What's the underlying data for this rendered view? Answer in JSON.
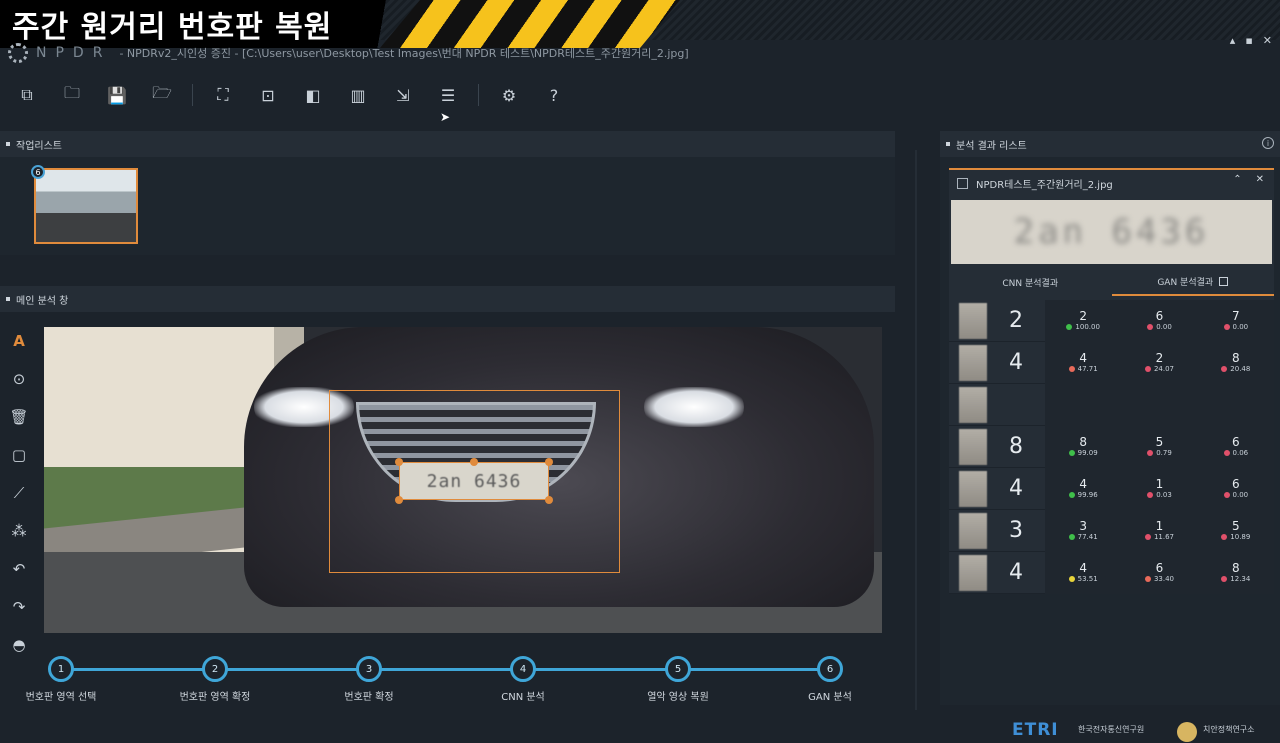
{
  "banner": {
    "title": "주간 원거리 번호판 복원"
  },
  "app": {
    "logo_text": "NPDR",
    "title_path": "- NPDRv2_시인성 증진 - [C:\\Users\\user\\Desktop\\Test Images\\번대 NPDR 테스트\\NPDR테스트_주간원거리_2.jpg]",
    "window_controls": [
      "▴",
      "▪",
      "✕"
    ]
  },
  "toolbar": {
    "buttons": [
      {
        "icon": "copy-icon",
        "glyph": "⧉"
      },
      {
        "icon": "folder-icon",
        "glyph": "🗀"
      },
      {
        "icon": "save-icon",
        "glyph": "💾"
      },
      {
        "icon": "open-folder-icon",
        "glyph": "🗁"
      },
      {
        "icon": "crop-icon",
        "glyph": "⛶"
      },
      {
        "icon": "focus-icon",
        "glyph": "⊡"
      },
      {
        "icon": "image-compare-icon",
        "glyph": "◧"
      },
      {
        "icon": "chart-icon",
        "glyph": "▥"
      },
      {
        "icon": "export-icon",
        "glyph": "⇲"
      },
      {
        "icon": "list-icon",
        "glyph": "☰"
      },
      {
        "icon": "settings-icon",
        "glyph": "⚙"
      },
      {
        "icon": "help-icon",
        "glyph": "?"
      }
    ]
  },
  "panels": {
    "worklist": "작업리스트",
    "main_analysis": "메인 분석 창",
    "result_list": "분석 결과 리스트"
  },
  "worklist": {
    "badge": "6"
  },
  "side_tools": [
    {
      "icon": "text-tool-icon",
      "glyph": "A"
    },
    {
      "icon": "capture-icon",
      "glyph": "⊙"
    },
    {
      "icon": "delete-icon",
      "glyph": "🗑"
    },
    {
      "icon": "rectangle-icon",
      "glyph": "▢"
    },
    {
      "icon": "line-icon",
      "glyph": "⟋"
    },
    {
      "icon": "points-icon",
      "glyph": "⁂"
    },
    {
      "icon": "undo-icon",
      "glyph": "↶"
    },
    {
      "icon": "redo-icon",
      "glyph": "↷"
    },
    {
      "icon": "view-icon",
      "glyph": "◓"
    }
  ],
  "main_image": {
    "plate_text": "2an 6436"
  },
  "steps": [
    {
      "num": "1",
      "label": "번호판 영역 선택"
    },
    {
      "num": "2",
      "label": "번호판 영역 확정"
    },
    {
      "num": "3",
      "label": "번호판 확정"
    },
    {
      "num": "4",
      "label": "CNN 분석"
    },
    {
      "num": "5",
      "label": "열악 영상 복원"
    },
    {
      "num": "6",
      "label": "GAN 분석"
    }
  ],
  "result": {
    "filename": "NPDR테스트_주간원거리_2.jpg",
    "controls": [
      "⌃",
      "✕"
    ],
    "plate_crop_text": "2an 6436",
    "tabs": [
      "CNN 분석결과",
      "GAN 분석결과"
    ],
    "info": "i",
    "rows": [
      {
        "big": "2",
        "cands": [
          {
            "c": "2",
            "p": "100.00",
            "col": "#3fbf4a"
          },
          {
            "c": "6",
            "p": "0.00",
            "col": "#e0506a"
          },
          {
            "c": "7",
            "p": "0.00",
            "col": "#e0506a"
          }
        ]
      },
      {
        "big": "4",
        "cands": [
          {
            "c": "4",
            "p": "47.71",
            "col": "#e86a5a"
          },
          {
            "c": "2",
            "p": "24.07",
            "col": "#e0506a"
          },
          {
            "c": "8",
            "p": "20.48",
            "col": "#e0506a"
          }
        ]
      },
      {
        "big": "",
        "cands": []
      },
      {
        "big": "8",
        "cands": [
          {
            "c": "8",
            "p": "99.09",
            "col": "#3fbf4a"
          },
          {
            "c": "5",
            "p": "0.79",
            "col": "#e0506a"
          },
          {
            "c": "6",
            "p": "0.06",
            "col": "#e0506a"
          }
        ]
      },
      {
        "big": "4",
        "cands": [
          {
            "c": "4",
            "p": "99.96",
            "col": "#3fbf4a"
          },
          {
            "c": "1",
            "p": "0.03",
            "col": "#e0506a"
          },
          {
            "c": "6",
            "p": "0.00",
            "col": "#e0506a"
          }
        ]
      },
      {
        "big": "3",
        "cands": [
          {
            "c": "3",
            "p": "77.41",
            "col": "#3fbf4a"
          },
          {
            "c": "1",
            "p": "11.67",
            "col": "#e0506a"
          },
          {
            "c": "5",
            "p": "10.89",
            "col": "#e0506a"
          }
        ]
      },
      {
        "big": "4",
        "cands": [
          {
            "c": "4",
            "p": "53.51",
            "col": "#e8d43a"
          },
          {
            "c": "6",
            "p": "33.40",
            "col": "#e86a5a"
          },
          {
            "c": "8",
            "p": "12.34",
            "col": "#e0506a"
          }
        ]
      }
    ]
  },
  "footer": {
    "etri": "ETRI",
    "etri_sub": "한국전자통신연구원",
    "police_sub": "치안정책연구소"
  }
}
